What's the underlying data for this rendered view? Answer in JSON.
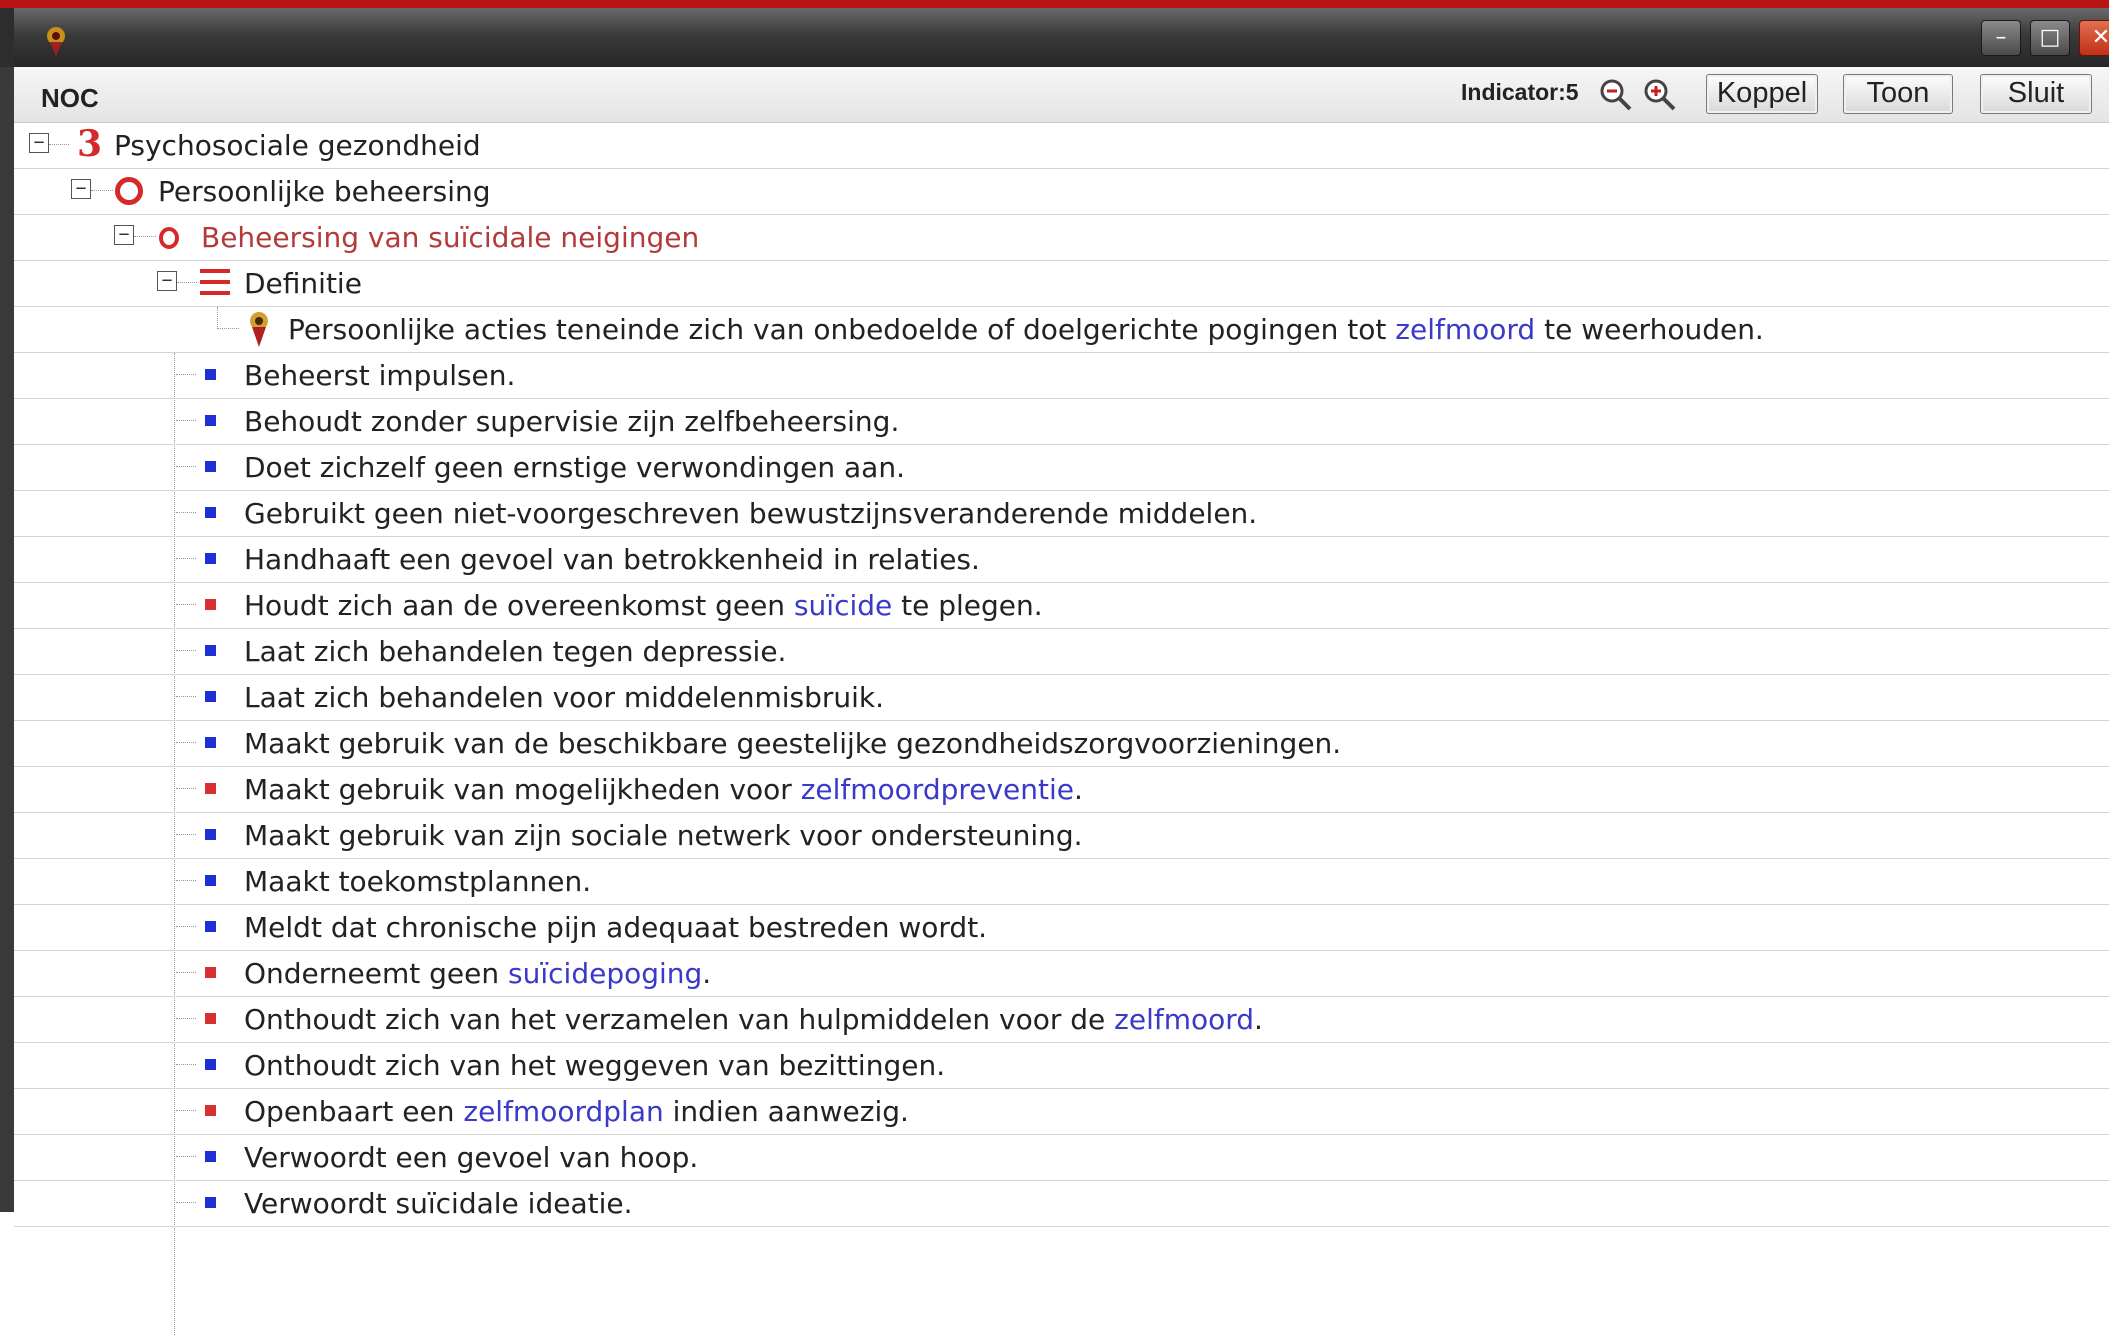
{
  "window": {
    "minimize_label": "–",
    "maximize_label": "□",
    "close_label": "✕"
  },
  "toolbar": {
    "title": "NOC",
    "indicator": "Indicator:5",
    "koppel_label": "Koppel",
    "toon_label": "Toon",
    "sluit_label": "Sluit"
  },
  "tree": {
    "domain": {
      "icon": "3",
      "label": "Psychosociale gezondheid"
    },
    "klasse": {
      "label": "Persoonlijke beheersing"
    },
    "resultaat": {
      "label": "Beheersing van suïcidale neigingen"
    },
    "definitie_header": {
      "label": "Definitie"
    },
    "definitie": {
      "before": "Persoonlijke acties teneinde zich van onbedoelde of doelgerichte pogingen tot ",
      "link": "zelfmoord",
      "after": " te weerhouden."
    },
    "indicators": [
      {
        "before": "Beheerst impulsen.",
        "link": "",
        "after": "",
        "color": "blue"
      },
      {
        "before": "Behoudt zonder supervisie zijn zelfbeheersing.",
        "link": "",
        "after": "",
        "color": "blue"
      },
      {
        "before": "Doet zichzelf geen ernstige verwondingen aan.",
        "link": "",
        "after": "",
        "color": "blue"
      },
      {
        "before": "Gebruikt geen niet-voorgeschreven bewustzijnsveranderende middelen.",
        "link": "",
        "after": "",
        "color": "blue"
      },
      {
        "before": "Handhaaft een gevoel van betrokkenheid in relaties.",
        "link": "",
        "after": "",
        "color": "blue"
      },
      {
        "before": "Houdt zich aan de overeenkomst geen ",
        "link": "suïcide",
        "after": " te plegen.",
        "color": "red"
      },
      {
        "before": "Laat zich behandelen tegen depressie.",
        "link": "",
        "after": "",
        "color": "blue"
      },
      {
        "before": "Laat zich behandelen voor middelenmisbruik.",
        "link": "",
        "after": "",
        "color": "blue"
      },
      {
        "before": "Maakt gebruik van de beschikbare geestelijke gezondheidszorgvoorzieningen.",
        "link": "",
        "after": "",
        "color": "blue"
      },
      {
        "before": "Maakt gebruik van mogelijkheden voor ",
        "link": "zelfmoordpreventie",
        "after": ".",
        "color": "red"
      },
      {
        "before": "Maakt gebruik van zijn sociale netwerk voor ondersteuning.",
        "link": "",
        "after": "",
        "color": "blue"
      },
      {
        "before": "Maakt toekomstplannen.",
        "link": "",
        "after": "",
        "color": "blue"
      },
      {
        "before": "Meldt dat chronische pijn adequaat bestreden wordt.",
        "link": "",
        "after": "",
        "color": "blue"
      },
      {
        "before": "Onderneemt geen ",
        "link": "suïcidepoging",
        "after": ".",
        "color": "red"
      },
      {
        "before": "Onthoudt zich van het verzamelen van hulpmiddelen voor de ",
        "link": "zelfmoord",
        "after": ".",
        "color": "red"
      },
      {
        "before": "Onthoudt zich van het weggeven van bezittingen.",
        "link": "",
        "after": "",
        "color": "blue"
      },
      {
        "before": "Openbaart een ",
        "link": "zelfmoordplan",
        "after": " indien aanwezig.",
        "color": "red"
      },
      {
        "before": "Verwoordt een gevoel van hoop.",
        "link": "",
        "after": "",
        "color": "blue"
      },
      {
        "before": "Verwoordt suïcidale ideatie.",
        "link": "",
        "after": "",
        "color": "blue"
      }
    ]
  },
  "colors": {
    "blue_bullet": "#1e2fd6",
    "red_bullet": "#d83030",
    "link": "#3a3ac8",
    "accent_text": "#b33a3a"
  }
}
